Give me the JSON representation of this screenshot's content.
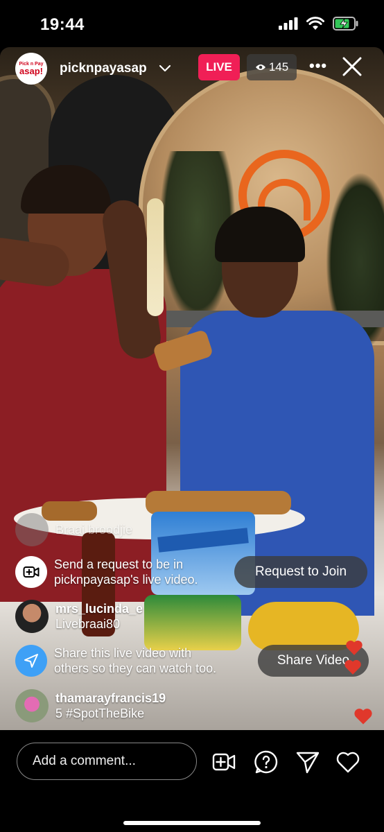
{
  "status_bar": {
    "time": "19:44"
  },
  "header": {
    "brand_avatar": {
      "top": "Pick n Pay",
      "bottom": "asap!"
    },
    "username": "picknpayasap",
    "live_label": "LIVE",
    "viewer_count": "145"
  },
  "comments": [
    {
      "text": "Braai broodjie",
      "faded": true
    },
    {
      "type": "system",
      "text_line1": "Send a request to be in",
      "text_line2": "picknpayasap's live video.",
      "button": "Request to Join"
    },
    {
      "user": "mrs_lucinda_e",
      "text": "Livebraai80"
    },
    {
      "type": "system",
      "text_line1": "Share this live video with",
      "text_line2": "others so they can watch too.",
      "button": "Share Video"
    },
    {
      "user": "thamarayfrancis19",
      "text": "5 #SpotTheBike"
    }
  ],
  "bottom_bar": {
    "comment_placeholder": "Add a comment..."
  },
  "colors": {
    "live": "#f01f56",
    "share_icon_bg": "#3ea0f6",
    "heart": "#e0382b"
  },
  "icons": [
    "wifi-icon",
    "signal-icon",
    "battery-icon",
    "chevron-down-icon",
    "eye-icon",
    "more-icon",
    "close-icon",
    "camera-plus-icon",
    "share-arrow-icon",
    "add-video-icon",
    "question-icon",
    "send-icon",
    "heart-icon"
  ]
}
